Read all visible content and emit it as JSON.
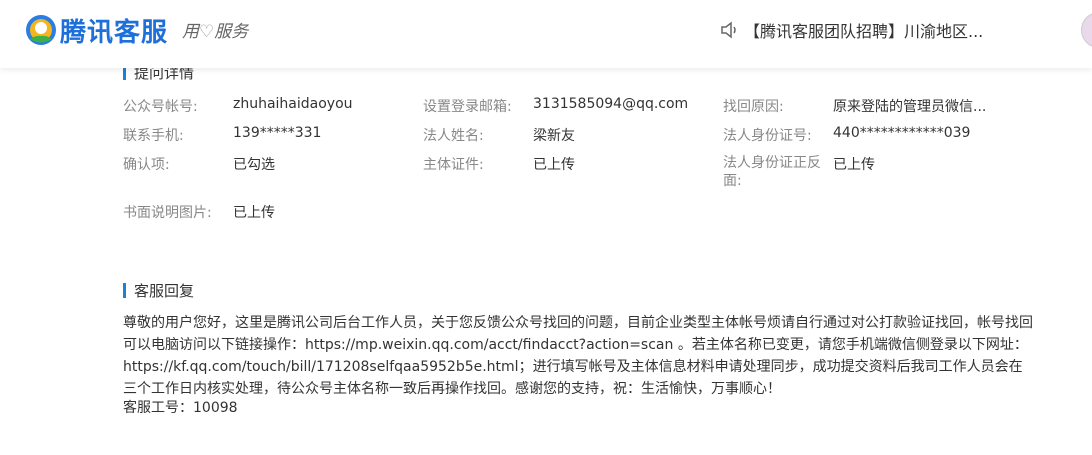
{
  "header": {
    "brand": "腾讯客服",
    "slogan_a": "用",
    "slogan_b": "服务",
    "notice": "【腾讯客服团队招聘】川渝地区..."
  },
  "details": {
    "title": "提问详情",
    "rows": [
      {
        "label": "公众号帐号:",
        "value": "zhuhaihaidaoyou"
      },
      {
        "label": "设置登录邮箱:",
        "value": "3131585094@qq.com"
      },
      {
        "label": "找回原因:",
        "value": "原来登陆的管理员微信..."
      },
      {
        "label": "联系手机:",
        "value": "139*****331"
      },
      {
        "label": "法人姓名:",
        "value": "梁新友"
      },
      {
        "label": "法人身份证号:",
        "value": "440************039"
      },
      {
        "label": "确认项:",
        "value": "已勾选"
      },
      {
        "label": "主体证件:",
        "value": "已上传"
      },
      {
        "label": "法人身份证正反面:",
        "value": "已上传"
      },
      {
        "label": "书面说明图片:",
        "value": "已上传"
      }
    ]
  },
  "reply": {
    "title": "客服回复",
    "body": "尊敬的用户您好，这里是腾讯公司后台工作人员，关于您反馈公众号找回的问题，目前企业类型主体帐号烦请自行通过对公打款验证找回，帐号找回可以电脑访问以下链接操作：https://mp.weixin.qq.com/acct/findacct?action=scan 。若主体名称已变更，请您手机端微信侧登录以下网址：https://kf.qq.com/touch/bill/171208selfqaa5952b5e.html；进行填写帐号及主体信息材料申请处理同步，成功提交资料后我司工作人员会在三个工作日内核实处理，待公众号主体名称一致后再操作找回。感谢您的支持，祝：生活愉快，万事顺心！",
    "staff_id": "客服工号：10098"
  },
  "colors": {
    "accent": "#1f80d6",
    "brand": "#1e6fd9"
  }
}
